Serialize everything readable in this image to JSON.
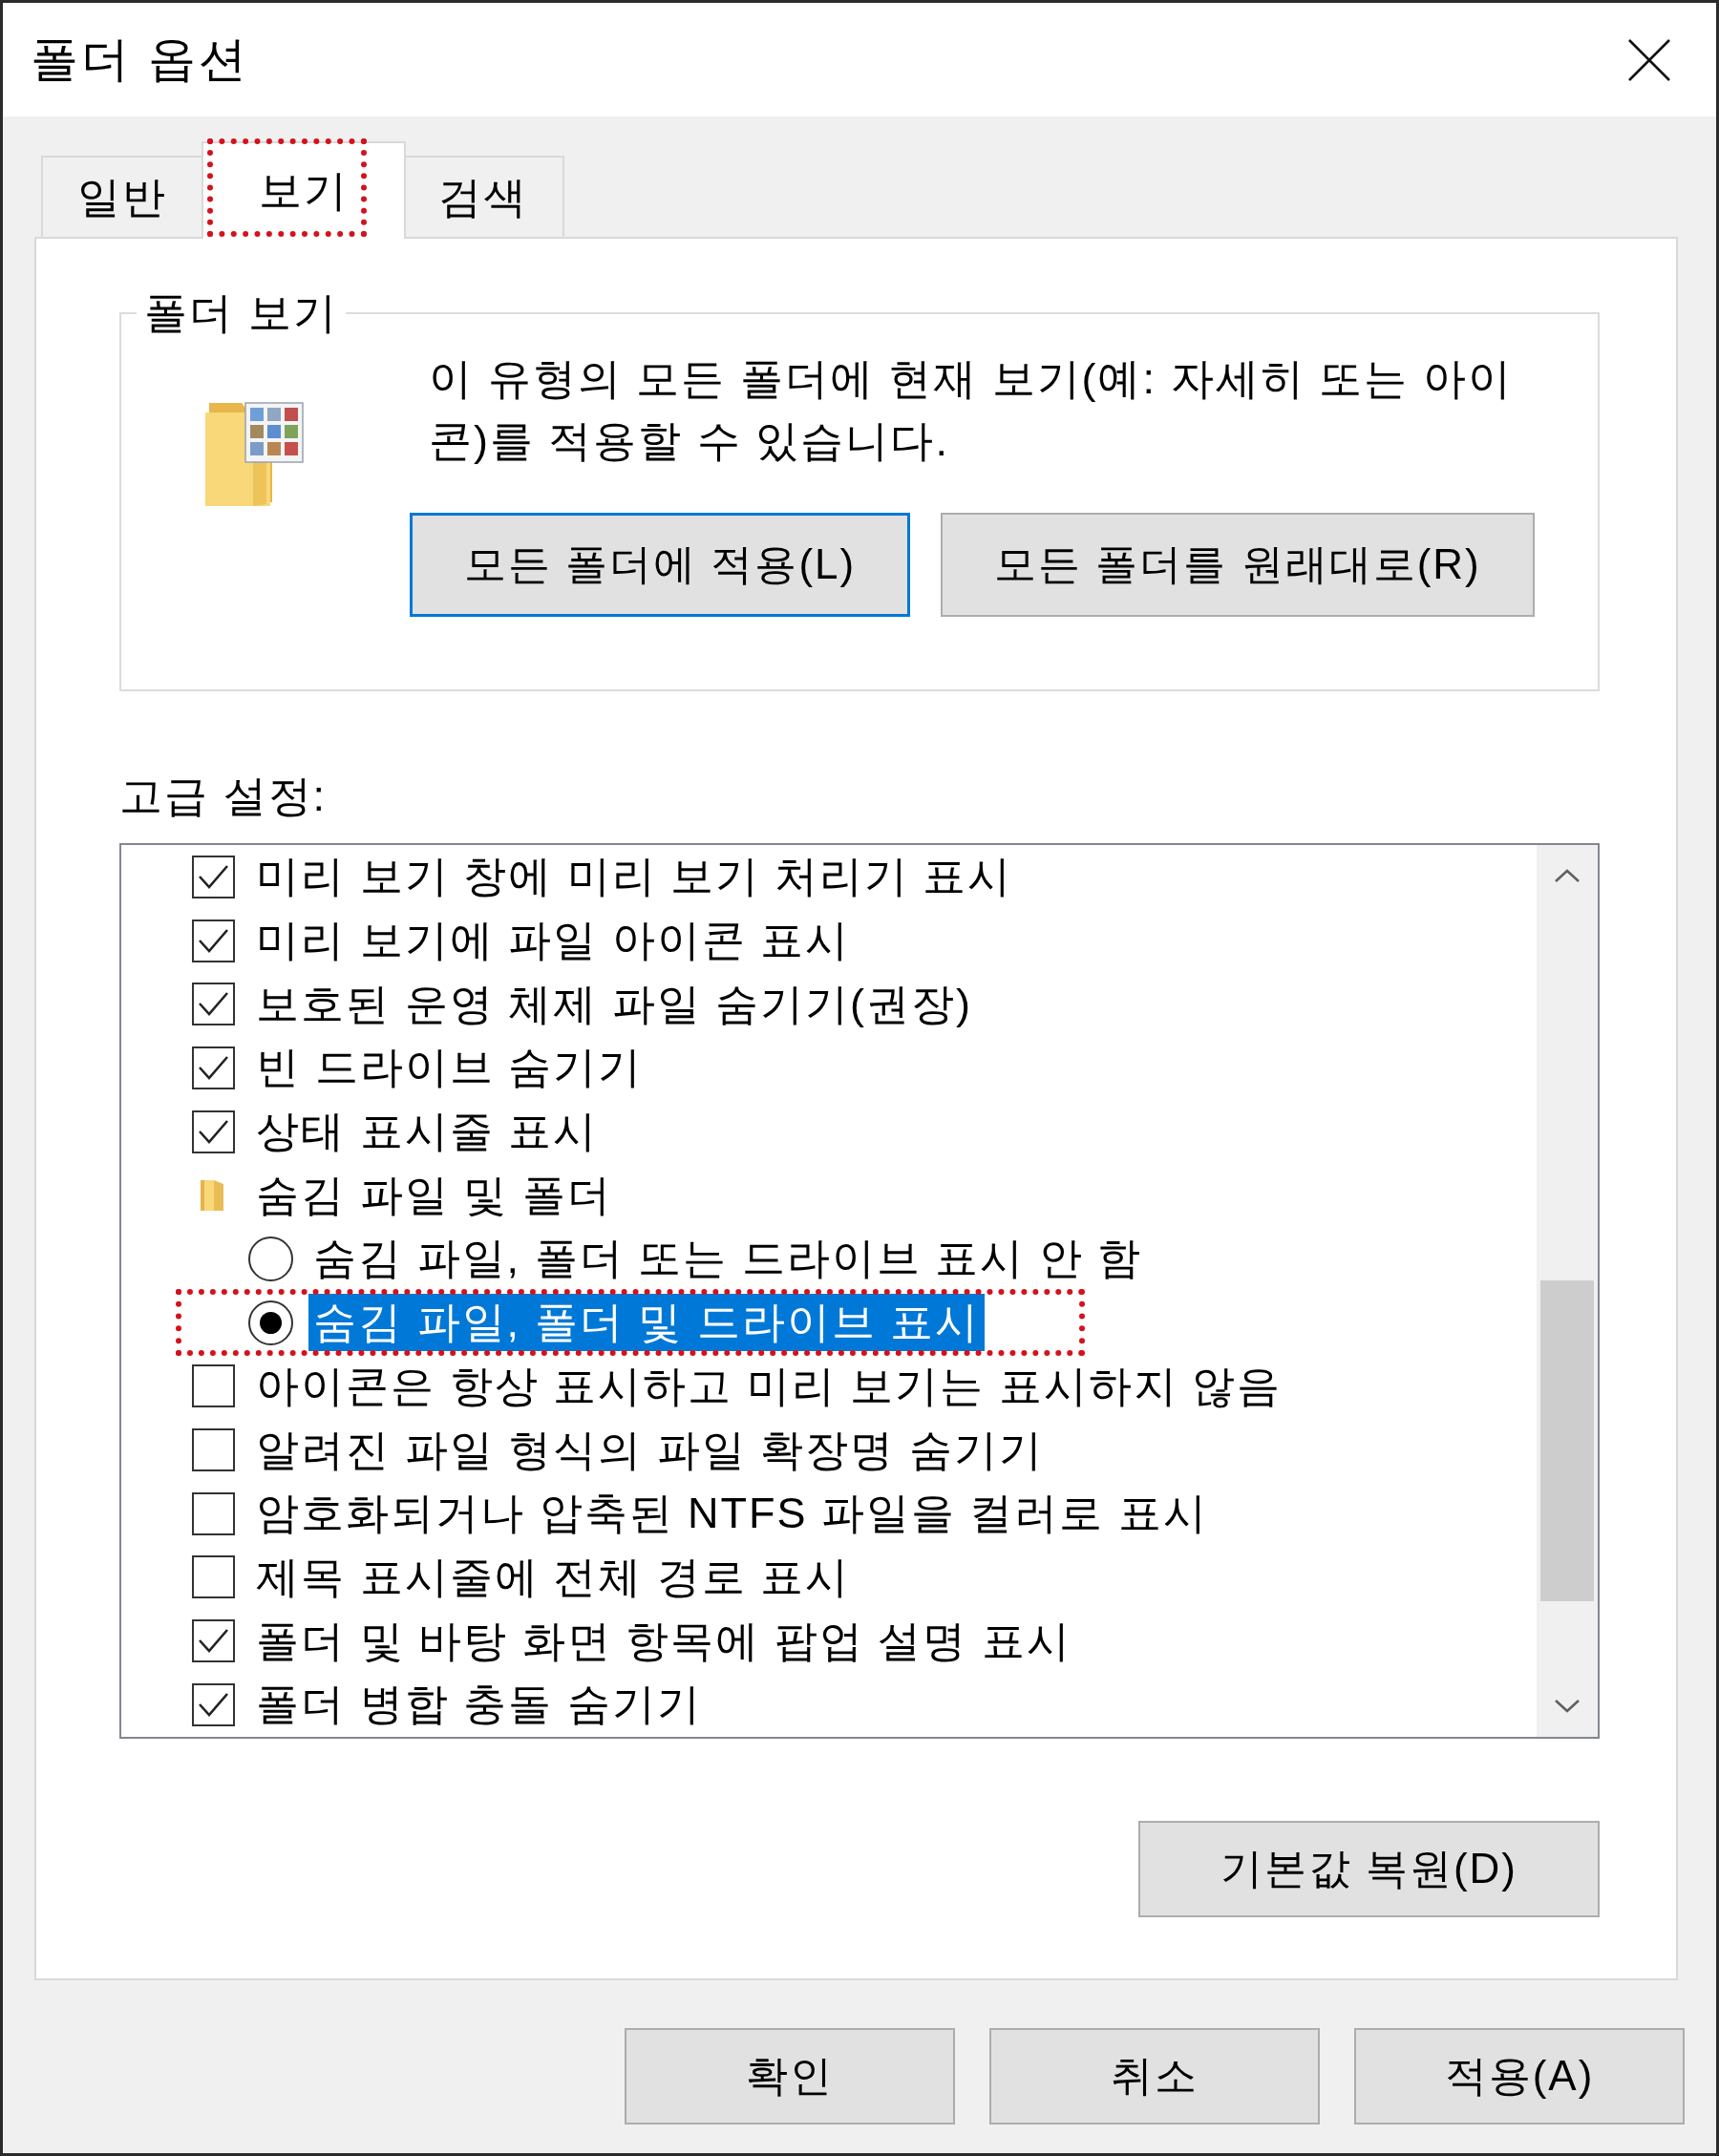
{
  "window": {
    "title": "폴더 옵션"
  },
  "tabs": [
    {
      "label": "일반",
      "selected": false,
      "annotated": false
    },
    {
      "label": "보기",
      "selected": true,
      "annotated": true
    },
    {
      "label": "검색",
      "selected": false,
      "annotated": false
    }
  ],
  "folder_views": {
    "title": "폴더 보기",
    "description": "이 유형의 모든 폴더에 현재 보기(예: 자세히 또는 아이콘)를 적용할 수 있습니다.",
    "buttons": [
      {
        "label": "모든 폴더에 적용(L)",
        "default": true
      },
      {
        "label": "모든 폴더를 원래대로(R)",
        "default": false
      }
    ]
  },
  "advanced_settings": {
    "label": "고급 설정:",
    "items": [
      {
        "kind": "checkbox",
        "label": "미리 보기 창에 미리 보기 처리기 표시",
        "checked": true,
        "selected": false,
        "annotated": false
      },
      {
        "kind": "checkbox",
        "label": "미리 보기에 파일 아이콘 표시",
        "checked": true,
        "selected": false,
        "annotated": false
      },
      {
        "kind": "checkbox",
        "label": "보호된 운영 체제 파일 숨기기(권장)",
        "checked": true,
        "selected": false,
        "annotated": false
      },
      {
        "kind": "checkbox",
        "label": "빈 드라이브 숨기기",
        "checked": true,
        "selected": false,
        "annotated": false
      },
      {
        "kind": "checkbox",
        "label": "상태 표시줄 표시",
        "checked": true,
        "selected": false,
        "annotated": false
      },
      {
        "kind": "group",
        "label": "숨김 파일 및 폴더",
        "selected": false,
        "annotated": false,
        "children": [
          {
            "kind": "radio",
            "label": "숨김 파일, 폴더 또는 드라이브 표시 안 함",
            "checked": false,
            "selected": false,
            "annotated": false
          },
          {
            "kind": "radio",
            "label": "숨김 파일, 폴더 및 드라이브 표시",
            "checked": true,
            "selected": true,
            "annotated": true
          }
        ]
      },
      {
        "kind": "checkbox",
        "label": "아이콘은 항상 표시하고 미리 보기는 표시하지 않음",
        "checked": false,
        "selected": false,
        "annotated": false
      },
      {
        "kind": "checkbox",
        "label": "알려진 파일 형식의 파일 확장명 숨기기",
        "checked": false,
        "selected": false,
        "annotated": false
      },
      {
        "kind": "checkbox",
        "label": "암호화되거나 압축된 NTFS 파일을 컬러로 표시",
        "checked": false,
        "selected": false,
        "annotated": false
      },
      {
        "kind": "checkbox",
        "label": "제목 표시줄에 전체 경로 표시",
        "checked": false,
        "selected": false,
        "annotated": false
      },
      {
        "kind": "checkbox",
        "label": "폴더 및 바탕 화면 항목에 팝업 설명 표시",
        "checked": true,
        "selected": false,
        "annotated": false
      },
      {
        "kind": "checkbox",
        "label": "폴더 병합 충돌 숨기기",
        "checked": true,
        "selected": false,
        "annotated": false
      }
    ],
    "restore_button": "기본값 복원(D)"
  },
  "dialog_buttons": [
    "확인",
    "취소",
    "적용(A)"
  ]
}
